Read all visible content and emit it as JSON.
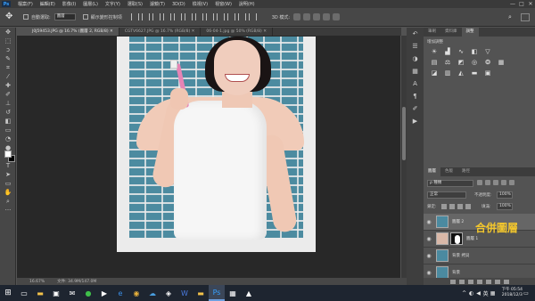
{
  "menu": {
    "app_logo": "Ps",
    "items": [
      "檔案(F)",
      "編輯(E)",
      "影像(I)",
      "圖層(L)",
      "文字(Y)",
      "選取(S)",
      "濾鏡(T)",
      "3D(D)",
      "檢視(V)",
      "視窗(W)",
      "說明(H)"
    ],
    "window_controls": [
      "—",
      "□",
      "✕"
    ]
  },
  "options": {
    "auto_select_label": "自動選取:",
    "auto_select_value": "圖層",
    "show_transform_label": "顯示變形控制項",
    "mode_3d_label": "3D 模式:"
  },
  "tabs": [
    "J0J59453.JPG @ 16.7% (圖層 2, RGB/8) ✕",
    "CGTV6627.JPG @ 16.7% (RGB/8) ✕",
    "06-04-1.jpg @ 50% (RGB/8) ✕"
  ],
  "status": {
    "zoom": "16.67%",
    "doc_size": "文件: 34.9M/147.0M"
  },
  "right_panel": {
    "tabs": [
      "筆刷",
      "資料庫",
      "調整"
    ],
    "adjust_title": "增加調整",
    "layers_tabs": [
      "圖層",
      "色版",
      "路徑"
    ],
    "filter_label": "ρ 種類",
    "blend_mode": "正常",
    "opacity_label": "不透明度:",
    "opacity_value": "100%",
    "lock_label": "鎖定:",
    "fill_label": "填滿:",
    "fill_value": "100%",
    "layers": [
      {
        "name": "圖層 2",
        "selected": true
      },
      {
        "name": "圖層 1",
        "selected": false
      },
      {
        "name": "背景 拷貝",
        "selected": false
      },
      {
        "name": "背景",
        "selected": false
      }
    ],
    "annotation": "合併圖層"
  },
  "taskbar": {
    "language": "英",
    "time": "下午 05:54",
    "date": "2018/12/3"
  },
  "icons": {
    "move": "move-tool-icon",
    "search": "search-icon",
    "eye": "eye-icon"
  },
  "colors": {
    "ps_blue": "#37a1ff",
    "annotation_yellow": "#f2c62d",
    "brick_blue": "#4c8ba0"
  }
}
